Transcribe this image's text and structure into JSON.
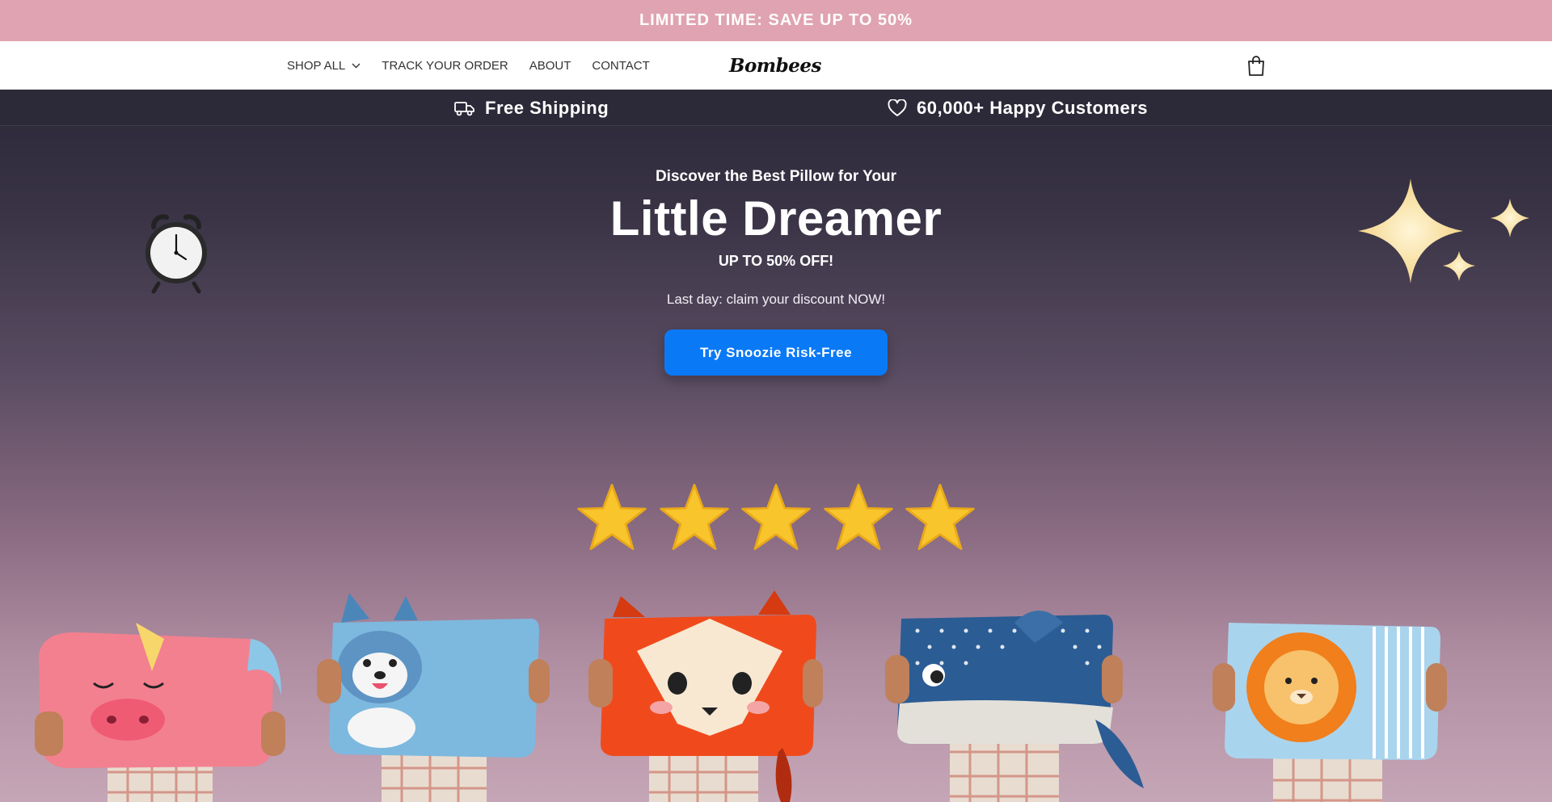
{
  "announcement": "LIMITED TIME: SAVE UP TO 50%",
  "nav": {
    "shop_all": "SHOP ALL",
    "track_order": "TRACK YOUR ORDER",
    "about": "ABOUT",
    "contact": "CONTACT"
  },
  "logo_text": "Bombees",
  "usps": {
    "shipping": "Free Shipping",
    "customers": "60,000+ Happy Customers"
  },
  "hero": {
    "eyebrow": "Discover the Best Pillow for Your",
    "headline": "Little Dreamer",
    "sub": "UP TO 50% OFF!",
    "note": "Last day: claim your discount NOW!",
    "cta": "Try Snoozie Risk-Free"
  },
  "rating": {
    "stars": 5,
    "max": 5
  },
  "icons": [
    "chevron-down-icon",
    "cart-icon",
    "truck-icon",
    "heart-icon",
    "alarm-clock-icon",
    "sparkles-icon",
    "star-icon"
  ],
  "colors": {
    "announcement_bg": "#e0a3b1",
    "cta_bg": "#0a79f6",
    "star": "#f8c52c"
  }
}
